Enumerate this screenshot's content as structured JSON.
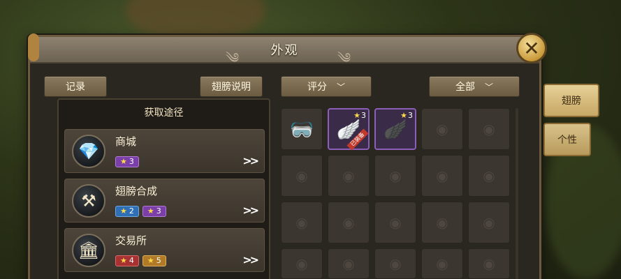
{
  "window": {
    "title": "外观"
  },
  "toolbar": {
    "record_label": "记录",
    "wing_desc_label": "翅膀说明",
    "sort_label": "评分",
    "filter_label": "全部"
  },
  "acquisition": {
    "header": "获取途径",
    "items": [
      {
        "name": "商城",
        "icon": "diamond-icon",
        "badges": [
          {
            "stars": "3",
            "color": "purple"
          }
        ]
      },
      {
        "name": "翅膀合成",
        "icon": "anvil-icon",
        "badges": [
          {
            "stars": "2",
            "color": "blue"
          },
          {
            "stars": "3",
            "color": "purple"
          }
        ]
      },
      {
        "name": "交易所",
        "icon": "trading-post-icon",
        "badges": [
          {
            "stars": "4",
            "color": "red"
          },
          {
            "stars": "5",
            "color": "gold"
          }
        ]
      }
    ],
    "arrow_text": ">>"
  },
  "grid": {
    "cells": [
      {
        "item": "silver-goggle-wing-icon",
        "stars": ""
      },
      {
        "item": "white-wing-icon",
        "stars": "3",
        "tag": "已装备"
      },
      {
        "item": "black-wing-icon",
        "stars": "3"
      }
    ]
  },
  "side_tabs": [
    {
      "label": "翅膀",
      "active": true
    },
    {
      "label": "个性",
      "active": false
    }
  ],
  "colors": {
    "badge_purple": "#7a3fa8",
    "badge_blue": "#2f6fb6",
    "badge_red": "#a83232",
    "badge_gold": "#b07a26",
    "selected_cell_border": "#8b5fb8"
  }
}
